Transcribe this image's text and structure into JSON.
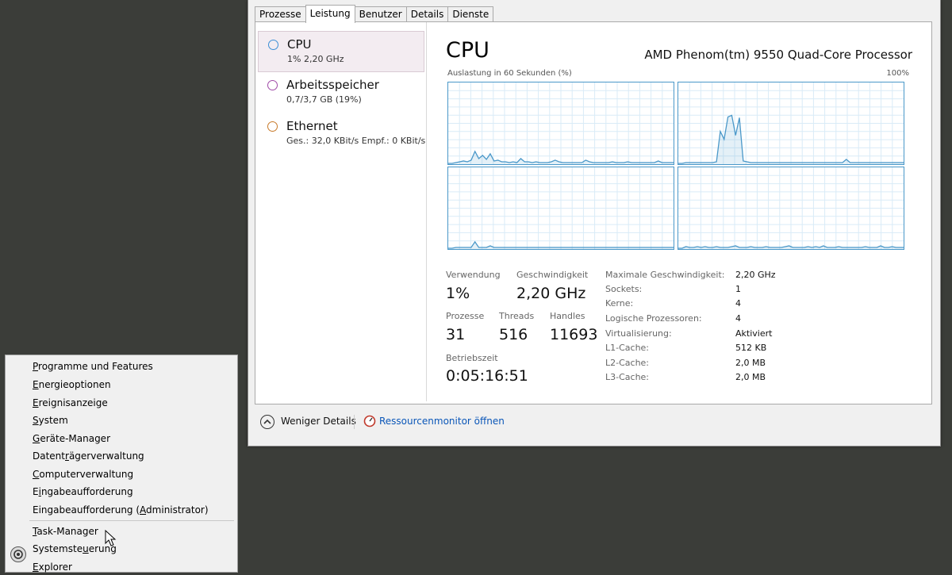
{
  "tabs": [
    "Prozesse",
    "Leistung",
    "Benutzer",
    "Details",
    "Dienste"
  ],
  "active_tab_index": 1,
  "sidebar": {
    "items": [
      {
        "name": "CPU",
        "sub": "1% 2,20 GHz",
        "color": "#3c8fd6",
        "icon": "cpu-circle-icon"
      },
      {
        "name": "Arbeitsspeicher",
        "sub": "0,7/3,7 GB (19%)",
        "color": "#a04aa8",
        "icon": "memory-circle-icon"
      },
      {
        "name": "Ethernet",
        "sub": "Ges.: 32,0 KBit/s  Empf.: 0 KBit/s",
        "color": "#c87a2a",
        "icon": "ethernet-circle-icon"
      }
    ]
  },
  "main": {
    "title": "CPU",
    "model": "AMD Phenom(tm) 9550 Quad-Core Processor",
    "graph_caption": "Auslastung in 60 Sekunden (%)",
    "graph_max": "100%",
    "graph_color": "#4a98c9",
    "stats": {
      "verwendung_label": "Verwendung",
      "verwendung": "1%",
      "geschwindigkeit_label": "Geschwindigkeit",
      "geschwindigkeit": "2,20 GHz",
      "prozesse_label": "Prozesse",
      "prozesse": "31",
      "threads_label": "Threads",
      "threads": "516",
      "handles_label": "Handles",
      "handles": "11693",
      "betriebszeit_label": "Betriebszeit",
      "betriebszeit": "0:05:16:51"
    },
    "specs": [
      {
        "key": "Maximale Geschwindigkeit:",
        "value": "2,20 GHz"
      },
      {
        "key": "Sockets:",
        "value": "1"
      },
      {
        "key": "Kerne:",
        "value": "4"
      },
      {
        "key": "Logische Prozessoren:",
        "value": "4"
      },
      {
        "key": "Virtualisierung:",
        "value": "Aktiviert"
      },
      {
        "key": "L1-Cache:",
        "value": "512 KB"
      },
      {
        "key": "L2-Cache:",
        "value": "2,0 MB"
      },
      {
        "key": "L3-Cache:",
        "value": "2,0 MB"
      }
    ],
    "core_usage": [
      [
        0,
        0,
        1,
        2,
        3,
        2,
        4,
        15,
        6,
        10,
        5,
        12,
        3,
        4,
        2,
        2,
        1,
        2,
        1,
        6,
        2,
        2,
        1,
        2,
        1,
        1,
        1,
        2,
        4,
        2,
        1,
        1,
        1,
        1,
        1,
        1,
        4,
        2,
        1,
        1,
        1,
        1,
        1,
        2,
        1,
        1,
        1,
        2,
        1,
        1,
        1,
        1,
        1,
        1,
        1,
        3,
        1,
        1,
        1,
        1
      ],
      [
        0,
        0,
        1,
        1,
        1,
        1,
        1,
        1,
        1,
        1,
        2,
        40,
        30,
        58,
        60,
        35,
        57,
        3,
        2,
        1,
        1,
        1,
        1,
        1,
        1,
        1,
        1,
        1,
        1,
        1,
        1,
        1,
        1,
        1,
        1,
        1,
        1,
        1,
        1,
        1,
        1,
        1,
        1,
        1,
        5,
        1,
        1,
        1,
        1,
        1,
        1,
        1,
        1,
        1,
        1,
        1,
        1,
        1,
        1,
        1
      ],
      [
        0,
        0,
        1,
        1,
        1,
        1,
        1,
        8,
        1,
        1,
        1,
        3,
        1,
        1,
        1,
        1,
        1,
        1,
        1,
        1,
        1,
        1,
        1,
        1,
        1,
        1,
        1,
        1,
        1,
        1,
        1,
        1,
        1,
        1,
        1,
        1,
        1,
        1,
        1,
        1,
        1,
        1,
        1,
        1,
        1,
        1,
        1,
        1,
        1,
        1,
        1,
        1,
        1,
        1,
        1,
        1,
        1,
        1,
        1,
        1
      ],
      [
        0,
        0,
        2,
        1,
        1,
        2,
        1,
        2,
        1,
        1,
        2,
        1,
        1,
        1,
        2,
        3,
        1,
        1,
        1,
        2,
        1,
        1,
        1,
        2,
        1,
        1,
        1,
        1,
        2,
        3,
        1,
        1,
        1,
        1,
        2,
        1,
        2,
        1,
        3,
        1,
        1,
        1,
        2,
        1,
        1,
        1,
        1,
        1,
        1,
        2,
        1,
        1,
        1,
        3,
        1,
        1,
        2,
        1,
        1,
        1
      ]
    ]
  },
  "footer": {
    "fewer_details": "Weniger Details",
    "resource_monitor": "Ressourcenmonitor öffnen"
  },
  "context_menu": {
    "items": [
      {
        "pre": "",
        "u": "P",
        "post": "rogramme und Features"
      },
      {
        "pre": "",
        "u": "E",
        "post": "nergieoptionen"
      },
      {
        "pre": "",
        "u": "E",
        "post": "reignisanzeige"
      },
      {
        "pre": "",
        "u": "S",
        "post": "ystem"
      },
      {
        "pre": "",
        "u": "G",
        "post": "eräte-Manager"
      },
      {
        "pre": "Datent",
        "u": "r",
        "post": "ägerverwaltung"
      },
      {
        "pre": "",
        "u": "C",
        "post": "omputerverwaltung"
      },
      {
        "pre": "E",
        "u": "i",
        "post": "ngabeaufforderung"
      },
      {
        "pre": "Eingabeaufforderung (",
        "u": "A",
        "post": "dministrator)"
      },
      {
        "pre": "",
        "u": "T",
        "post": "ask-Manager"
      },
      {
        "pre": "Systemste",
        "u": "u",
        "post": "erung"
      },
      {
        "pre": "",
        "u": "E",
        "post": "xplorer"
      }
    ]
  }
}
